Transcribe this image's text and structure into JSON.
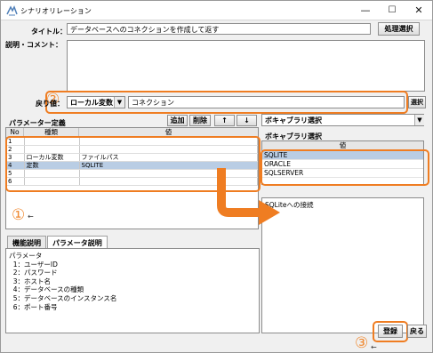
{
  "window": {
    "title": "シナリオリレーション",
    "minimize": "—",
    "maximize": "☐",
    "close": "✕"
  },
  "form": {
    "title_label": "タイトル：",
    "title_value": "データベースへのコネクションを作成して返す",
    "process_select_button": "処理選択",
    "comment_label": "説明・コメント：",
    "comment_value": "",
    "return_label": "戻り値：",
    "return_type": "ローカル変数",
    "return_value": "コネクション",
    "return_select_button": "選択"
  },
  "params": {
    "title": "パラメーター定義",
    "add_button": "追加",
    "delete_button": "削除",
    "up_button": "↑",
    "down_button": "↓",
    "columns": [
      "No",
      "種類",
      "値"
    ],
    "rows": [
      {
        "no": "1",
        "type": "",
        "value": ""
      },
      {
        "no": "2",
        "type": "",
        "value": ""
      },
      {
        "no": "3",
        "type": "ローカル変数",
        "value": "ファイルパス"
      },
      {
        "no": "4",
        "type": "定数",
        "value": "SQLITE"
      },
      {
        "no": "5",
        "type": "",
        "value": ""
      },
      {
        "no": "6",
        "type": "",
        "value": ""
      }
    ],
    "selected_row": 4
  },
  "vocab": {
    "dropdown_label": "ボキャブラリ選択",
    "panel_title": "ボキャブラリ選択",
    "column": "値",
    "items": [
      "SQLITE",
      "ORACLE",
      "SQLSERVER"
    ],
    "selected_index": 0,
    "description": "SQLiteへの接続"
  },
  "tabs": {
    "items": [
      "機能説明",
      "パラメータ説明"
    ],
    "active_index": 1
  },
  "param_description": [
    "パラメータ",
    "  1：ユーザーID",
    "  2：パスワード",
    "  3：ホスト名",
    "  4：データベースの種類",
    "  5：データベースのインスタンス名",
    "  6：ポート番号"
  ],
  "footer": {
    "register_button": "登録",
    "back_button": "戻る"
  },
  "annotations": {
    "marker_1": "①",
    "marker_2": "②",
    "marker_3": "③",
    "accent_color": "#ef7d22"
  }
}
